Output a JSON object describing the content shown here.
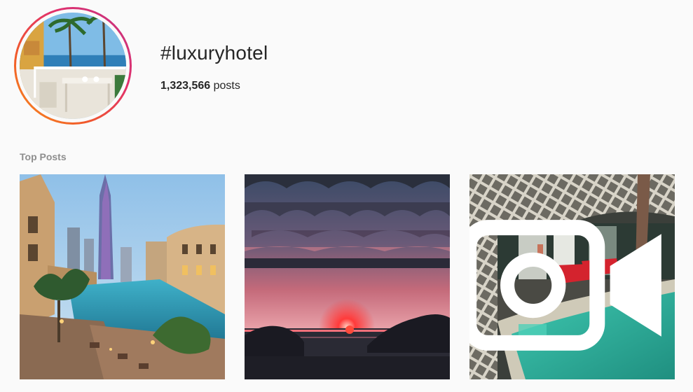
{
  "header": {
    "hashtag": "#luxuryhotel",
    "post_count_number": "1,323,566",
    "post_count_suffix": " posts"
  },
  "section": {
    "label": "Top Posts"
  },
  "posts": [
    {
      "subject": "Dubai downtown canal promenade at dusk",
      "media": "image"
    },
    {
      "subject": "Sunset over the sea with rocks",
      "media": "image"
    },
    {
      "subject": "Villa with turquoise pool and red loungers",
      "media": "video",
      "icon": "video-camera-icon"
    }
  ],
  "colors": {
    "background": "#fafafa",
    "text": "#262626",
    "muted": "#8e8e8e",
    "ring_start": "#f7931e",
    "ring_end": "#c13584"
  }
}
